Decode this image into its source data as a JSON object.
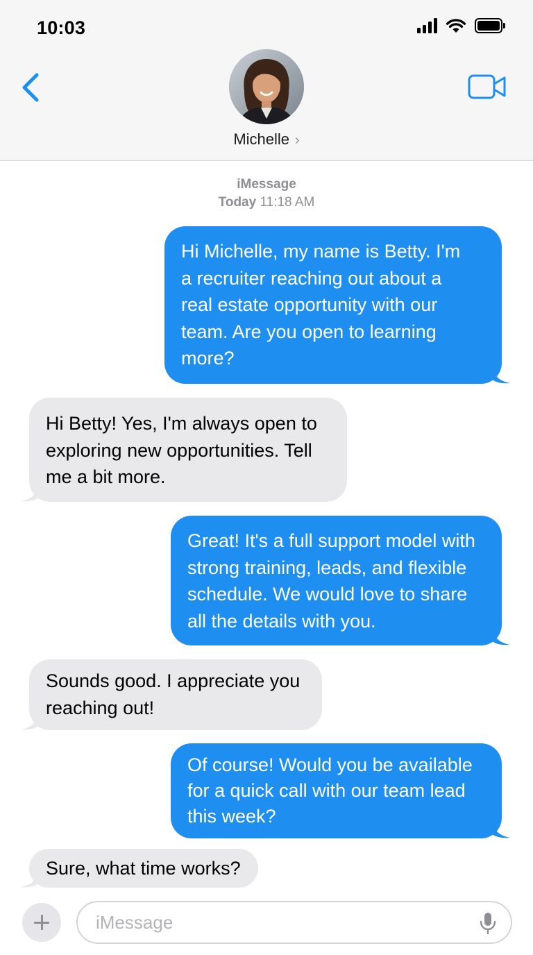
{
  "status_bar": {
    "time": "10:03"
  },
  "header": {
    "contact_name": "Michelle",
    "back_icon": "chevron-left-icon",
    "video_icon": "video-camera-icon",
    "accent": "#1f8ef1"
  },
  "thread": {
    "service": "iMessage",
    "timestamp_day": "Today",
    "timestamp_time": "11:18 AM",
    "messages": [
      {
        "direction": "outgoing",
        "text": "Hi Michelle, my name is Betty. I'm\na recruiter reaching out about a\nreal estate opportunity with our\nteam. Are you open to learning\nmore?"
      },
      {
        "direction": "incoming",
        "text": "Hi Betty! Yes, I'm always open to\nexploring new opportunities. Tell\nme a bit more."
      },
      {
        "direction": "outgoing",
        "text": "Great! It's a full support model with\nstrong training, leads, and flexible\nschedule. We would love to share\nall the details with you."
      },
      {
        "direction": "incoming",
        "text": "Sounds good. I appreciate you\nreaching out!"
      },
      {
        "direction": "outgoing",
        "text": "Of course! Would you be available\nfor a quick call with our team lead\nthis week?"
      },
      {
        "direction": "incoming",
        "text": "Sure, what time works?"
      }
    ]
  },
  "composer": {
    "placeholder": "iMessage",
    "plus_icon": "plus-icon",
    "mic_icon": "microphone-icon"
  },
  "colors": {
    "outgoing_bubble": "#1f8ef1",
    "incoming_bubble": "#e9e9eb",
    "meta_text": "#8e8e93"
  }
}
